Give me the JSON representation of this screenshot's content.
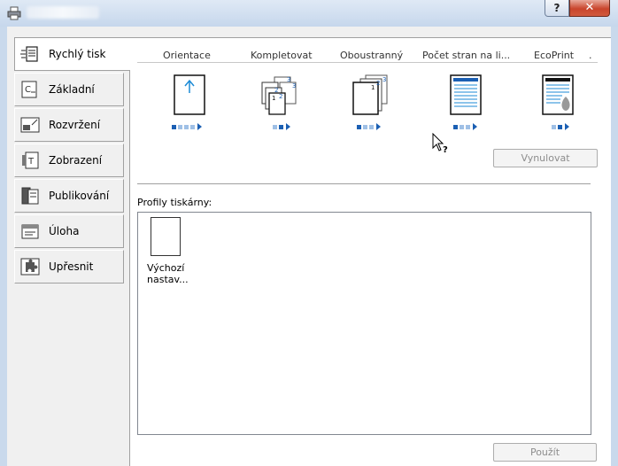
{
  "window": {
    "help_label": "?",
    "close_label": "✕",
    "title_icon": "printer-icon"
  },
  "sidebar": {
    "items": [
      {
        "label": "Rychlý tisk",
        "icon": "quick-print-icon",
        "active": true
      },
      {
        "label": "Základní",
        "icon": "basic-icon"
      },
      {
        "label": "Rozvržení",
        "icon": "layout-icon"
      },
      {
        "label": "Zobrazení",
        "icon": "imaging-icon"
      },
      {
        "label": "Publikování",
        "icon": "publishing-icon"
      },
      {
        "label": "Úloha",
        "icon": "job-icon"
      },
      {
        "label": "Upřesnit",
        "icon": "advanced-puzzle-icon"
      }
    ]
  },
  "quick_print": {
    "columns": [
      {
        "label": "Orientace",
        "icon": "orientation-portrait-icon"
      },
      {
        "label": "Kompletovat",
        "icon": "collate-icon"
      },
      {
        "label": "Oboustranný",
        "icon": "duplex-icon"
      },
      {
        "label": "Počet stran na li...",
        "icon": "pages-per-sheet-icon"
      },
      {
        "label": "EcoPrint",
        "icon": "ecoprint-icon"
      }
    ],
    "overflow_marker": ".",
    "reset_label": "Vynulovat"
  },
  "profiles": {
    "label": "Profily tiskárny:",
    "items": [
      {
        "label_line1": "Výchozí",
        "label_line2": "nastav..."
      }
    ]
  },
  "footer": {
    "apply_label": "Použít"
  },
  "colors": {
    "accent": "#1b5fb3",
    "accent_light": "#9fc0e6",
    "panel": "#ffffff",
    "window": "#f0f0f0",
    "close": "#c9452c"
  }
}
